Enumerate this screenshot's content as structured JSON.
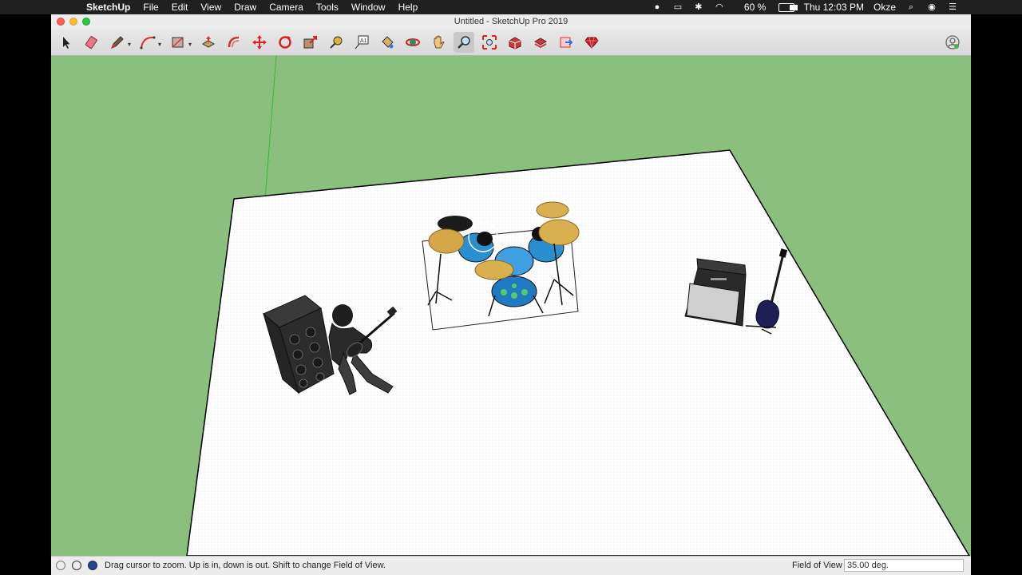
{
  "menubar": {
    "app_name": "SketchUp",
    "menus": [
      "File",
      "Edit",
      "View",
      "Draw",
      "Camera",
      "Tools",
      "Window",
      "Help"
    ],
    "battery_percent": "60 %",
    "battery_level": 0.6,
    "clock": "Thu 12:03 PM",
    "user": "Okze",
    "status_icons": [
      "record-icon",
      "airplay-icon",
      "bluetooth-icon",
      "wifi-icon",
      "battery-icon"
    ],
    "right_icons": [
      "spotlight-search-icon",
      "siri-icon",
      "notification-center-icon"
    ]
  },
  "window": {
    "title": "Untitled - SketchUp Pro 2019"
  },
  "toolbar": {
    "tools": [
      {
        "name": "select-tool",
        "icon": "arrow-cursor-icon"
      },
      {
        "name": "eraser-tool",
        "icon": "eraser-icon"
      },
      {
        "name": "line-tool",
        "icon": "pencil-icon",
        "dropdown": true
      },
      {
        "name": "arc-tool",
        "icon": "arc-icon",
        "dropdown": true
      },
      {
        "name": "rectangle-tool",
        "icon": "rectangle-icon",
        "dropdown": true
      },
      {
        "name": "push-pull-tool",
        "icon": "push-pull-icon"
      },
      {
        "name": "offset-tool",
        "icon": "offset-icon"
      },
      {
        "name": "move-tool",
        "icon": "move-icon"
      },
      {
        "name": "rotate-tool",
        "icon": "rotate-icon"
      },
      {
        "name": "scale-tool",
        "icon": "scale-icon"
      },
      {
        "name": "tape-measure-tool",
        "icon": "tape-measure-icon"
      },
      {
        "name": "text-tool",
        "icon": "text-icon"
      },
      {
        "name": "paint-bucket-tool",
        "icon": "paint-bucket-icon"
      },
      {
        "name": "orbit-tool",
        "icon": "orbit-icon"
      },
      {
        "name": "pan-tool",
        "icon": "hand-icon"
      },
      {
        "name": "zoom-tool",
        "icon": "magnifier-icon",
        "active": true
      },
      {
        "name": "zoom-extents-tool",
        "icon": "zoom-extents-icon"
      },
      {
        "name": "3d-warehouse-tool",
        "icon": "warehouse-icon"
      },
      {
        "name": "extension-warehouse-tool",
        "icon": "extension-warehouse-icon"
      },
      {
        "name": "layout-tool",
        "icon": "layout-icon"
      },
      {
        "name": "ruby-console-tool",
        "icon": "ruby-icon"
      }
    ],
    "account_icon": "user-account-icon"
  },
  "colors": {
    "sky_ground": "#8bbf7d",
    "ground_plane": "#ffffff",
    "green_axis": "#2fbf2f",
    "active_tool_bg": "#c8c8c8"
  },
  "statusbar": {
    "icons": [
      "geo-location-icon",
      "credits-icon",
      "instructor-icon"
    ],
    "message": "Drag cursor to zoom.  Up is in, down is out. Shift to change Field of View.",
    "fov_label": "Field of View",
    "fov_value": "35.00 deg."
  }
}
